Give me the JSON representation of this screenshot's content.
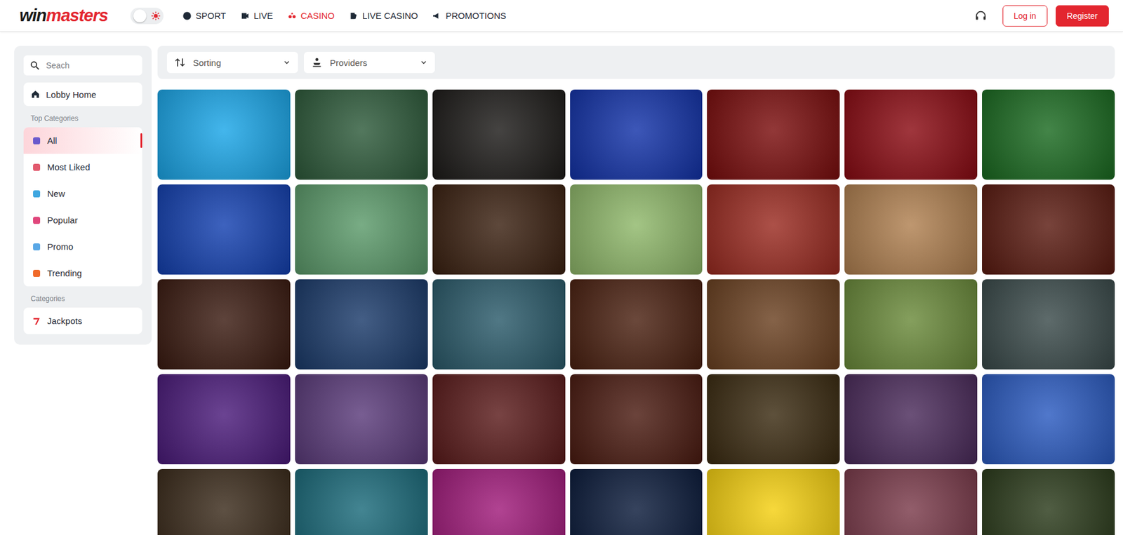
{
  "header": {
    "logo": {
      "part1": "win",
      "part2": "masters"
    },
    "theme_toggle": {
      "on": false
    },
    "nav": [
      {
        "label": "SPORT",
        "selected": false
      },
      {
        "label": "LIVE",
        "selected": false
      },
      {
        "label": "CASINO",
        "selected": true
      },
      {
        "label": "LIVE CASINO",
        "selected": false
      },
      {
        "label": "PROMOTIONS",
        "selected": false
      }
    ],
    "login": "Log in",
    "register": "Register"
  },
  "sidebar": {
    "search": {
      "placeholder": "Seach"
    },
    "home": "Lobby Home",
    "top_label": "Top Categories",
    "top_items": [
      {
        "label": "All",
        "selected": true
      },
      {
        "label": "Most Liked",
        "selected": false
      },
      {
        "label": "New",
        "selected": false
      },
      {
        "label": "Popular",
        "selected": false
      },
      {
        "label": "Promo",
        "selected": false
      },
      {
        "label": "Trending",
        "selected": false
      }
    ],
    "categories_label": "Categories",
    "categories": [
      {
        "label": "Jackpots",
        "selected": false
      }
    ]
  },
  "filters": {
    "sorting": "Sorting",
    "providers": "Providers"
  },
  "games": [
    {
      "color": "#1aa6e8"
    },
    {
      "color": "#2d5a3a"
    },
    {
      "color": "#1c1a18"
    },
    {
      "color": "#1232a8"
    },
    {
      "color": "#7a0c0c"
    },
    {
      "color": "#8a0a12"
    },
    {
      "color": "#1a6a20"
    },
    {
      "color": "#1340b0"
    },
    {
      "color": "#5b9a6a"
    },
    {
      "color": "#3a2010"
    },
    {
      "color": "#8fb86a"
    },
    {
      "color": "#9a2a20"
    },
    {
      "color": "#b08050"
    },
    {
      "color": "#5a1a10"
    },
    {
      "color": "#3a1a10"
    },
    {
      "color": "#1a3a6a"
    },
    {
      "color": "#2a5a6a"
    },
    {
      "color": "#4a2010"
    },
    {
      "color": "#6a4020"
    },
    {
      "color": "#6a8a3a"
    },
    {
      "color": "#3a4a4a"
    },
    {
      "color": "#4a1a7a"
    },
    {
      "color": "#5a3a7a"
    },
    {
      "color": "#5a1a1a"
    },
    {
      "color": "#4a1a10"
    },
    {
      "color": "#3a2a10"
    },
    {
      "color": "#4a2a5a"
    },
    {
      "color": "#2a5ac0"
    },
    {
      "color": "#3a2a1a"
    },
    {
      "color": "#1a6a7a"
    },
    {
      "color": "#a01a7a"
    },
    {
      "color": "#0a1a3a"
    },
    {
      "color": "#f5d010"
    },
    {
      "color": "#7a3a4a"
    },
    {
      "color": "#2a3a1a"
    }
  ]
}
